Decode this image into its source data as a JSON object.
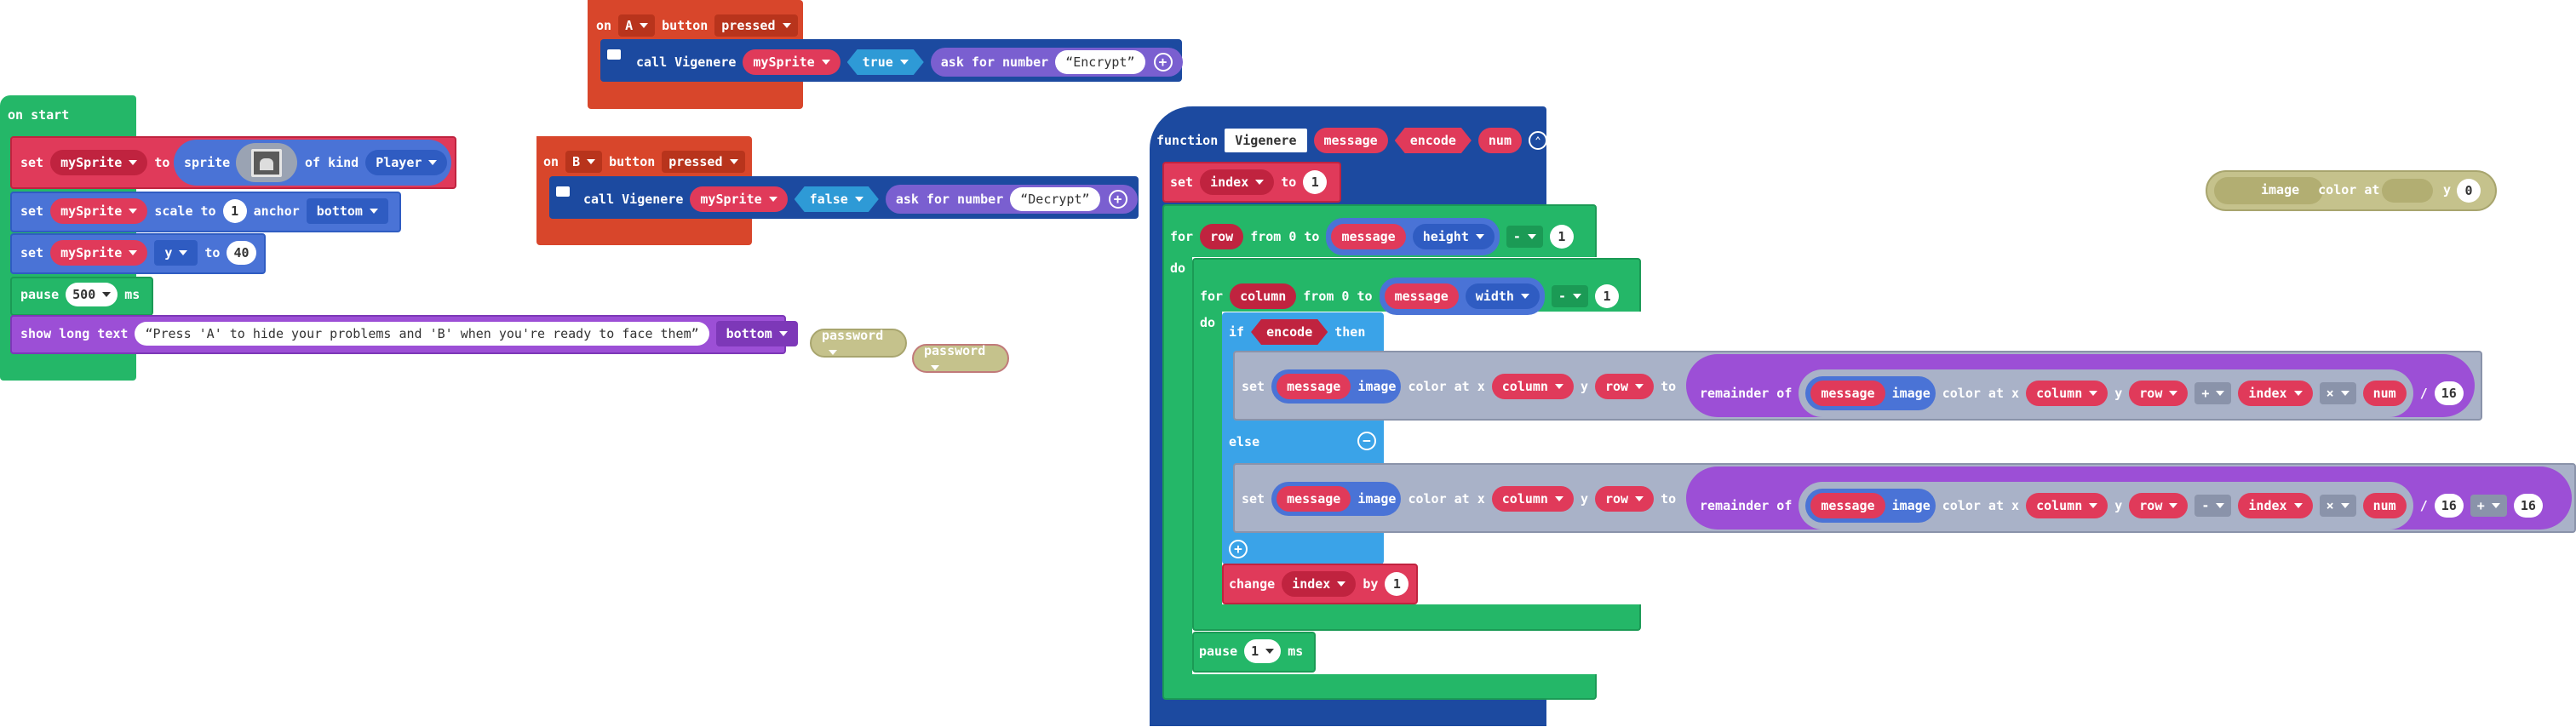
{
  "colors": {
    "green": "#24b768",
    "red_event": "#d8462b",
    "dark_blue": "#1c4aa0",
    "blue": "#4a73d6",
    "var_red": "#e03a5a",
    "purple": "#9c4fd6",
    "grey": "#a9b2c8",
    "olive": "#c5c28c"
  },
  "on_start": {
    "label": "on start",
    "set_sprite": {
      "set": "set",
      "var": "mySprite",
      "to": "to",
      "sprite": "sprite",
      "of_kind": "of kind",
      "kind": "Player"
    },
    "set_scale": {
      "set": "set",
      "var": "mySprite",
      "scale_to": "scale to",
      "value": "1",
      "anchor": "anchor",
      "anchor_value": "bottom"
    },
    "set_y": {
      "set": "set",
      "var": "mySprite",
      "prop": "y",
      "to": "to",
      "value": "40"
    },
    "pause": {
      "label": "pause",
      "value": "500",
      "unit": "ms"
    },
    "show_text": {
      "label": "show long text",
      "text": "Press 'A' to hide your problems and 'B' when you're ready to face them",
      "position": "bottom"
    }
  },
  "floating": {
    "password1": "password",
    "password2": "password"
  },
  "on_a": {
    "on": "on",
    "button": "A",
    "label": "button",
    "event": "pressed",
    "call": {
      "label": "call Vigenere",
      "var": "mySprite",
      "bool": "true",
      "ask": "ask for number",
      "text": "Encrypt"
    }
  },
  "on_b": {
    "on": "on",
    "button": "B",
    "label": "button",
    "event": "pressed",
    "call": {
      "label": "call Vigenere",
      "var": "mySprite",
      "bool": "false",
      "ask": "ask for number",
      "text": "Decrypt"
    }
  },
  "image_color": {
    "image": "image",
    "color_at_x": "color at x",
    "y": "y",
    "value": "0"
  },
  "function": {
    "label": "function",
    "name": "Vigenere",
    "params": [
      "message",
      "encode",
      "num"
    ],
    "set_index": {
      "set": "set",
      "var": "index",
      "to": "to",
      "value": "1"
    },
    "for_row": {
      "for": "for",
      "var": "row",
      "from": "from 0 to",
      "msg": "message",
      "prop": "height",
      "op": "-",
      "value": "1",
      "do": "do"
    },
    "for_col": {
      "for": "for",
      "var": "column",
      "from": "from 0 to",
      "msg": "message",
      "prop": "width",
      "op": "-",
      "value": "1",
      "do": "do"
    },
    "if": {
      "label": "if",
      "cond": "encode",
      "then": "then",
      "else": "else"
    },
    "set1": {
      "set": "set",
      "msg": "message",
      "image": "image",
      "color_at_x": "color at x",
      "col": "column",
      "y": "y",
      "row": "row",
      "to": "to",
      "rem": "remainder of",
      "op1": "+",
      "index": "index",
      "op2": "×",
      "num": "num",
      "div": "/",
      "val": "16"
    },
    "set2": {
      "set": "set",
      "msg": "message",
      "image": "image",
      "color_at_x": "color at x",
      "col": "column",
      "y": "y",
      "row": "row",
      "to": "to",
      "rem": "remainder of",
      "op1": "-",
      "index": "index",
      "op2": "×",
      "num": "num",
      "div": "/",
      "val": "16",
      "op3": "+",
      "val2": "16"
    },
    "change": {
      "label": "change",
      "var": "index",
      "by": "by",
      "value": "1"
    },
    "pause": {
      "label": "pause",
      "value": "1",
      "unit": "ms"
    }
  }
}
